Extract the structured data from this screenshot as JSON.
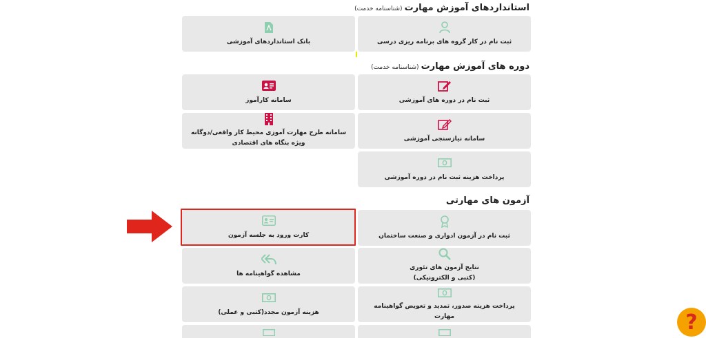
{
  "sections": {
    "standards": {
      "title": "استانداردهای آموزش مهارت",
      "sub": "(شناسنامه خدمت)"
    },
    "courses": {
      "title": "دوره های آموزش مهارت",
      "sub": "(شناسنامه خدمت)"
    },
    "exams": {
      "title": "آزمون های مهارتی"
    }
  },
  "cards": {
    "register_curriculum": "ثبت نام در کار گروه های برنامه ریزی درسی",
    "standards_bank": "بانک استانداردهای آموزشی",
    "register_courses": "ثبت نام در دوره های آموزشی",
    "trainee_system": "سامانه کارآموز",
    "needs_assessment": "سامانه نیازسنجی آموزشی",
    "workplace_line1": "سامانه طرح مهارت آموزی محیط کار واقعی/دوگانه",
    "workplace_line2": "ویژه بنگاه های اقتصادی",
    "course_fee": "پرداخت هزینه ثبت نام در دوره آموزشی",
    "register_exam_building": "ثبت نام در آزمون ادواری و صنعت ساختمان",
    "exam_entry_card": "کارت ورود به جلسه آزمون",
    "theory_results_line1": "نتایج آزمون های تئوری",
    "theory_results_line2": "(کتبی و الکترونیکی)",
    "view_certificates": "مشاهده گواهینامه ها",
    "certificate_fee": "پرداخت هزینه صدور، تمدید و تعویض گواهینامه مهارت",
    "retake_fee": "هزینه آزمون مجدد(کتبی و عملی)"
  },
  "help": {
    "label": "?"
  },
  "colors": {
    "card_bg": "#e8e8e8",
    "accent_red": "#e0251d",
    "icon_green": "#8fcfb0",
    "icon_crimson": "#cc1144",
    "help_orange": "#f5a100"
  },
  "icons": {
    "register_curriculum": "user-icon",
    "standards_bank": "pdf-file-icon",
    "register_courses": "edit-icon",
    "trainee_system": "id-card-icon",
    "needs_assessment": "edit-icon",
    "workplace": "building-icon",
    "course_fee": "money-icon",
    "register_exam_building": "award-icon",
    "exam_entry_card": "id-card-icon",
    "theory_results": "search-icon",
    "view_certificates": "reply-all-icon",
    "certificate_fee": "money-icon",
    "retake_fee": "money-icon"
  }
}
